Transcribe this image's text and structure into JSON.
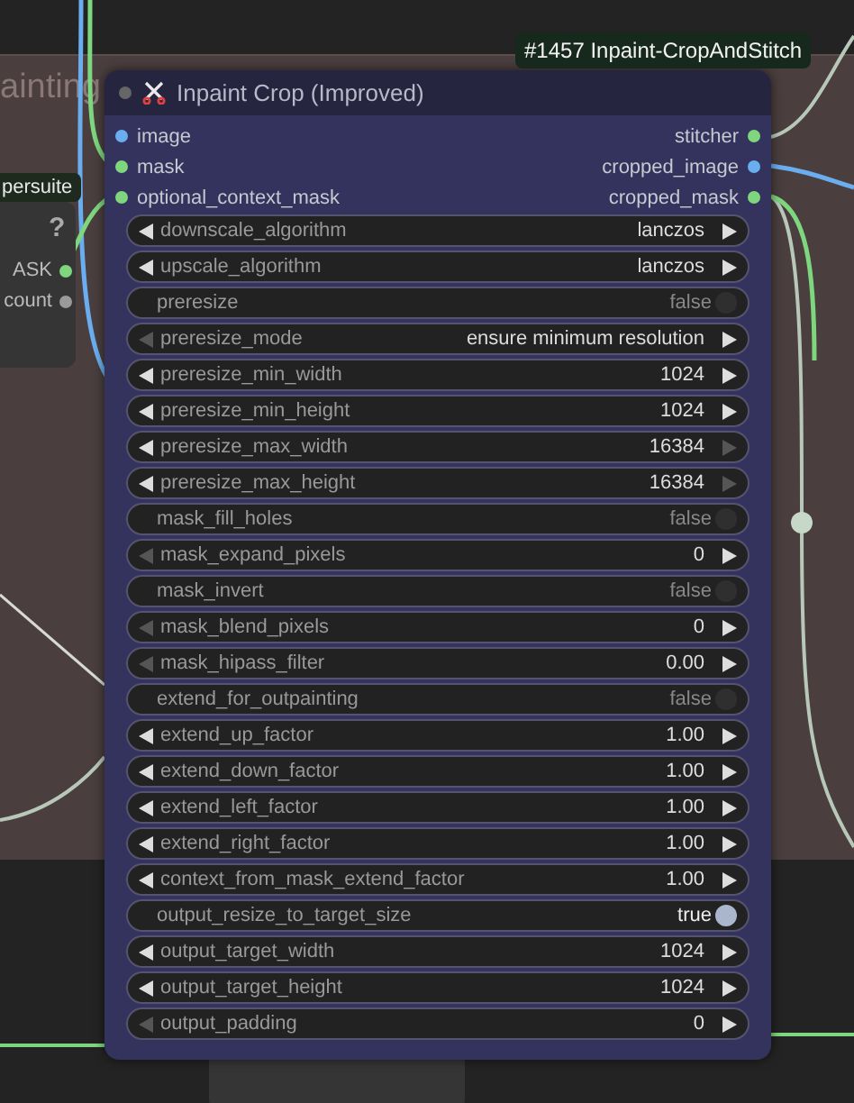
{
  "group": {
    "title": "ainting"
  },
  "side_node": {
    "badge": "persuite",
    "help": "?",
    "outputs": [
      {
        "label": "ASK",
        "color": "#7ed67e"
      },
      {
        "label": "count",
        "color": "#9a9a9a"
      }
    ]
  },
  "node_badge": "#1457 Inpaint-CropAndStitch",
  "node": {
    "title": "Inpaint Crop (Improved)",
    "inputs": [
      {
        "label": "image",
        "color": "#6aaef0"
      },
      {
        "label": "mask",
        "color": "#7ed67e"
      },
      {
        "label": "optional_context_mask",
        "color": "#7ed67e"
      }
    ],
    "outputs": [
      {
        "label": "stitcher",
        "color": "#7ed67e"
      },
      {
        "label": "cropped_image",
        "color": "#6aaef0"
      },
      {
        "label": "cropped_mask",
        "color": "#7ed67e"
      }
    ],
    "widgets": [
      {
        "kind": "combo",
        "label": "downscale_algorithm",
        "value": "lanczos",
        "at_min": false,
        "at_max": false
      },
      {
        "kind": "combo",
        "label": "upscale_algorithm",
        "value": "lanczos",
        "at_min": false,
        "at_max": false
      },
      {
        "kind": "toggle",
        "label": "preresize",
        "value": "false",
        "on": false
      },
      {
        "kind": "combo",
        "label": "preresize_mode",
        "value": "ensure minimum resolution",
        "at_min": true,
        "at_max": false
      },
      {
        "kind": "number",
        "label": "preresize_min_width",
        "value": "1024",
        "at_min": false,
        "at_max": false
      },
      {
        "kind": "number",
        "label": "preresize_min_height",
        "value": "1024",
        "at_min": false,
        "at_max": false
      },
      {
        "kind": "number",
        "label": "preresize_max_width",
        "value": "16384",
        "at_min": false,
        "at_max": true
      },
      {
        "kind": "number",
        "label": "preresize_max_height",
        "value": "16384",
        "at_min": false,
        "at_max": true
      },
      {
        "kind": "toggle",
        "label": "mask_fill_holes",
        "value": "false",
        "on": false
      },
      {
        "kind": "number",
        "label": "mask_expand_pixels",
        "value": "0",
        "at_min": true,
        "at_max": false
      },
      {
        "kind": "toggle",
        "label": "mask_invert",
        "value": "false",
        "on": false
      },
      {
        "kind": "number",
        "label": "mask_blend_pixels",
        "value": "0",
        "at_min": true,
        "at_max": false
      },
      {
        "kind": "number",
        "label": "mask_hipass_filter",
        "value": "0.00",
        "at_min": true,
        "at_max": false
      },
      {
        "kind": "toggle",
        "label": "extend_for_outpainting",
        "value": "false",
        "on": false
      },
      {
        "kind": "number",
        "label": "extend_up_factor",
        "value": "1.00",
        "at_min": false,
        "at_max": false
      },
      {
        "kind": "number",
        "label": "extend_down_factor",
        "value": "1.00",
        "at_min": false,
        "at_max": false
      },
      {
        "kind": "number",
        "label": "extend_left_factor",
        "value": "1.00",
        "at_min": false,
        "at_max": false
      },
      {
        "kind": "number",
        "label": "extend_right_factor",
        "value": "1.00",
        "at_min": false,
        "at_max": false
      },
      {
        "kind": "number",
        "label": "context_from_mask_extend_factor",
        "value": "1.00",
        "at_min": false,
        "at_max": false
      },
      {
        "kind": "toggle",
        "label": "output_resize_to_target_size",
        "value": "true",
        "on": true
      },
      {
        "kind": "number",
        "label": "output_target_width",
        "value": "1024",
        "at_min": false,
        "at_max": false
      },
      {
        "kind": "number",
        "label": "output_target_height",
        "value": "1024",
        "at_min": false,
        "at_max": false
      },
      {
        "kind": "number",
        "label": "output_padding",
        "value": "0",
        "at_min": true,
        "at_max": false
      }
    ]
  }
}
